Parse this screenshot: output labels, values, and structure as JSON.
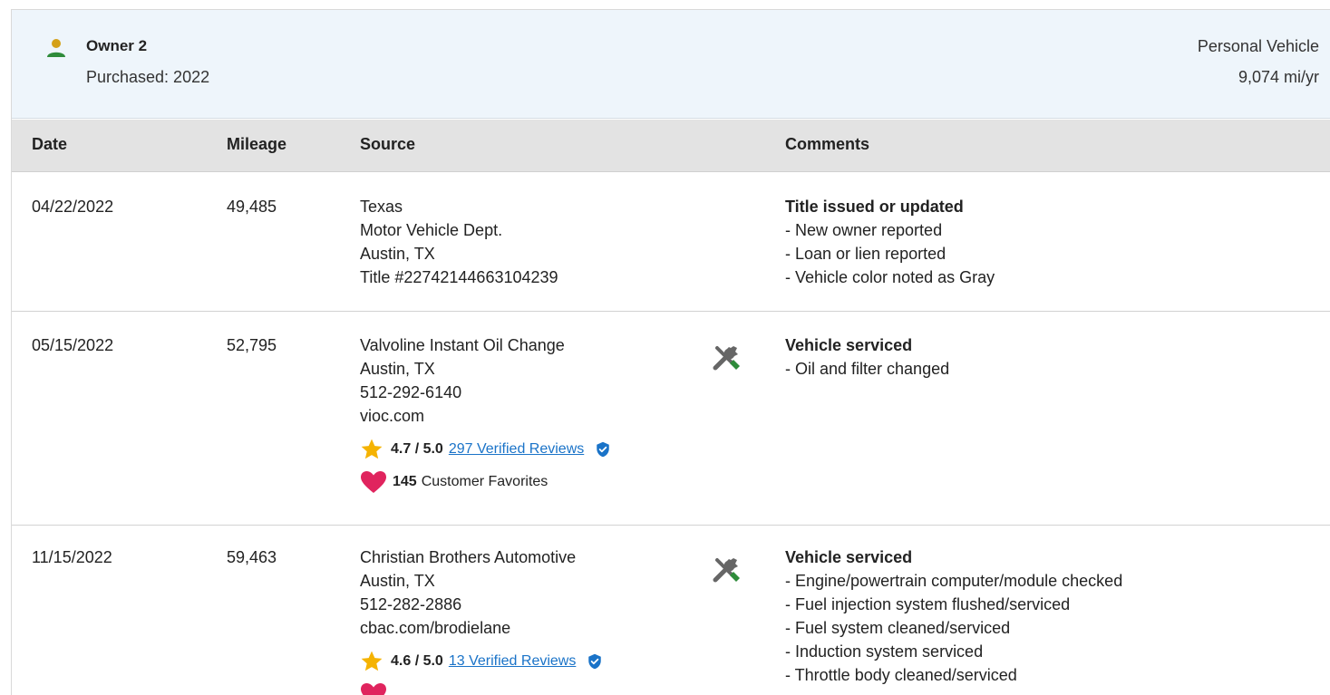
{
  "owner": {
    "name": "Owner 2",
    "purchased": "Purchased: 2022",
    "vehicle_type": "Personal Vehicle",
    "miles_per_year": "9,074 mi/yr"
  },
  "columns": {
    "date": "Date",
    "mileage": "Mileage",
    "source": "Source",
    "comments": "Comments"
  },
  "records": [
    {
      "date": "04/22/2022",
      "mileage": "49,485",
      "source": [
        "Texas",
        "Motor Vehicle Dept.",
        "Austin, TX",
        "Title #22742144663104239"
      ],
      "comment_title": "Title issued or updated",
      "comment_items": [
        "- New owner reported",
        "- Loan or lien reported",
        "- Vehicle color noted as Gray"
      ]
    },
    {
      "date": "05/15/2022",
      "mileage": "52,795",
      "source": [
        "Valvoline Instant Oil Change",
        "Austin, TX",
        "512-292-6140",
        "vioc.com"
      ],
      "rating": "4.7 / 5.0",
      "reviews": "297 Verified Reviews",
      "favorites_count": "145",
      "favorites_label": "Customer Favorites",
      "comment_title": "Vehicle serviced",
      "comment_items": [
        "- Oil and filter changed"
      ]
    },
    {
      "date": "11/15/2022",
      "mileage": "59,463",
      "source": [
        "Christian Brothers Automotive",
        "Austin, TX",
        "512-282-2886",
        "cbac.com/brodielane"
      ],
      "rating": "4.6 / 5.0",
      "reviews": "13 Verified Reviews",
      "comment_title": "Vehicle serviced",
      "comment_items": [
        "- Engine/powertrain computer/module checked",
        "- Fuel injection system flushed/serviced",
        "- Fuel system cleaned/serviced",
        "- Induction system serviced",
        "- Throttle body cleaned/serviced"
      ]
    }
  ],
  "colors": {
    "header_bg": "#eef5fb",
    "table_head_bg": "#e3e3e3",
    "link": "#1a73c8",
    "star": "#f5b301",
    "heart": "#e0245e",
    "owner_icon_head": "#d4a017",
    "owner_icon_body": "#2e8b3a",
    "verified_badge": "#1a73c8"
  },
  "icons": {
    "owner": "person-icon",
    "service": "wrench-screwdriver-icon",
    "rating": "star-icon",
    "verified": "verified-check-icon",
    "favorites": "heart-icon"
  }
}
